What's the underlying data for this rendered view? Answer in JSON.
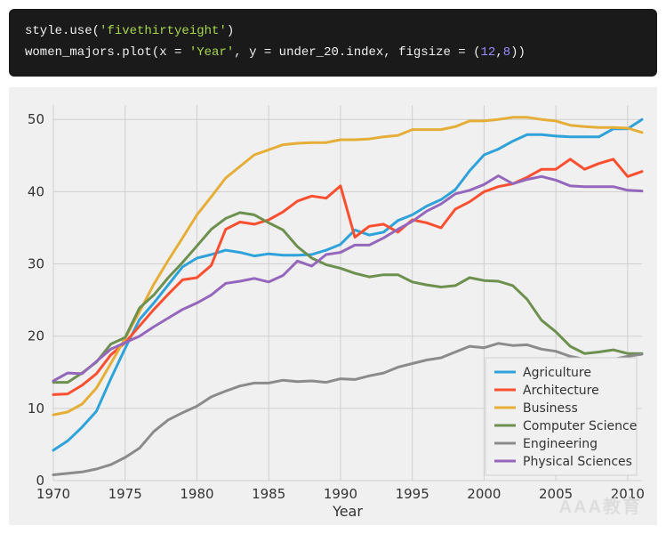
{
  "code": {
    "line1_pre": "style.use(",
    "line1_str": "'fivethirtyeight'",
    "line1_post": ")",
    "line2_pre": "women_majors.plot(x = ",
    "line2_str1": "'Year'",
    "line2_mid": ", y = under_20.index, figsize = (",
    "line2_num1": "12",
    "line2_comma": ",",
    "line2_num2": "8",
    "line2_post": "))"
  },
  "chart_data": {
    "type": "line",
    "xlabel": "Year",
    "ylabel": "",
    "xlim": [
      1970,
      2011
    ],
    "ylim": [
      0,
      52
    ],
    "xticks": [
      1970,
      1975,
      1980,
      1985,
      1990,
      1995,
      2000,
      2005,
      2010
    ],
    "yticks": [
      0,
      10,
      20,
      30,
      40,
      50
    ],
    "x": [
      1970,
      1971,
      1972,
      1973,
      1974,
      1975,
      1976,
      1977,
      1978,
      1979,
      1980,
      1981,
      1982,
      1983,
      1984,
      1985,
      1986,
      1987,
      1988,
      1989,
      1990,
      1991,
      1992,
      1993,
      1994,
      1995,
      1996,
      1997,
      1998,
      1999,
      2000,
      2001,
      2002,
      2003,
      2004,
      2005,
      2006,
      2007,
      2008,
      2009,
      2010,
      2011
    ],
    "series": [
      {
        "name": "Agriculture",
        "color": "#30a2da",
        "values": [
          4.2,
          5.5,
          7.4,
          9.6,
          14.1,
          18.3,
          22.3,
          24.6,
          27.1,
          29.6,
          30.8,
          31.3,
          31.9,
          31.6,
          31.1,
          31.4,
          31.2,
          31.2,
          31.3,
          31.9,
          32.7,
          34.7,
          34.0,
          34.4,
          36.0,
          36.8,
          38.0,
          38.9,
          40.3,
          42.9,
          45.1,
          45.9,
          47.0,
          47.9,
          47.9,
          47.7,
          47.6,
          47.6,
          47.6,
          48.7,
          48.7,
          50.0
        ]
      },
      {
        "name": "Architecture",
        "color": "#fc4f30",
        "values": [
          11.9,
          12.0,
          13.2,
          14.8,
          17.4,
          19.1,
          21.4,
          23.7,
          25.8,
          27.8,
          28.1,
          29.8,
          34.8,
          35.8,
          35.5,
          36.1,
          37.2,
          38.7,
          39.4,
          39.1,
          40.8,
          33.7,
          35.2,
          35.5,
          34.4,
          36.1,
          35.7,
          35.0,
          37.6,
          38.6,
          40.0,
          40.7,
          41.1,
          42.0,
          43.1,
          43.1,
          44.5,
          43.1,
          43.9,
          44.5,
          42.1,
          42.8
        ]
      },
      {
        "name": "Business",
        "color": "#e5ae38",
        "values": [
          9.1,
          9.5,
          10.6,
          12.8,
          16.2,
          19.7,
          23.4,
          27.2,
          30.5,
          33.6,
          36.8,
          39.3,
          41.9,
          43.5,
          45.1,
          45.8,
          46.5,
          46.7,
          46.8,
          46.8,
          47.2,
          47.2,
          47.3,
          47.6,
          47.8,
          48.6,
          48.6,
          48.6,
          49.0,
          49.8,
          49.8,
          50.0,
          50.3,
          50.3,
          50.0,
          49.8,
          49.2,
          49.0,
          48.9,
          48.9,
          48.8,
          48.2
        ]
      },
      {
        "name": "Computer Science",
        "color": "#6d904f",
        "values": [
          13.6,
          13.6,
          14.9,
          16.4,
          18.9,
          19.8,
          23.9,
          25.7,
          28.1,
          30.2,
          32.5,
          34.8,
          36.3,
          37.1,
          36.8,
          35.7,
          34.7,
          32.4,
          30.8,
          29.9,
          29.4,
          28.7,
          28.2,
          28.5,
          28.5,
          27.5,
          27.1,
          26.8,
          27.0,
          28.1,
          27.7,
          27.6,
          27.0,
          25.1,
          22.2,
          20.6,
          18.6,
          17.6,
          17.8,
          18.1,
          17.6,
          17.6
        ]
      },
      {
        "name": "Engineering",
        "color": "#8b8b8b",
        "values": [
          0.8,
          1.0,
          1.2,
          1.6,
          2.2,
          3.2,
          4.5,
          6.8,
          8.4,
          9.4,
          10.3,
          11.6,
          12.4,
          13.1,
          13.5,
          13.5,
          13.9,
          13.7,
          13.8,
          13.6,
          14.1,
          14.0,
          14.5,
          14.9,
          15.7,
          16.2,
          16.7,
          17.0,
          17.8,
          18.6,
          18.4,
          19.0,
          18.7,
          18.8,
          18.2,
          17.9,
          17.2,
          16.8,
          16.5,
          16.8,
          17.2,
          17.5
        ]
      },
      {
        "name": "Physical Sciences",
        "color": "#9467bd",
        "values": [
          13.8,
          14.9,
          14.8,
          16.5,
          18.2,
          19.1,
          20.0,
          21.3,
          22.5,
          23.7,
          24.6,
          25.7,
          27.3,
          27.6,
          28.0,
          27.5,
          28.4,
          30.4,
          29.7,
          31.3,
          31.6,
          32.6,
          32.6,
          33.6,
          34.8,
          35.9,
          37.3,
          38.3,
          39.7,
          40.2,
          41.0,
          42.2,
          41.1,
          41.7,
          42.1,
          41.6,
          40.8,
          40.7,
          40.7,
          40.7,
          40.2,
          40.1
        ]
      }
    ],
    "legend_position": "lower right"
  },
  "watermark": "AAA教育"
}
